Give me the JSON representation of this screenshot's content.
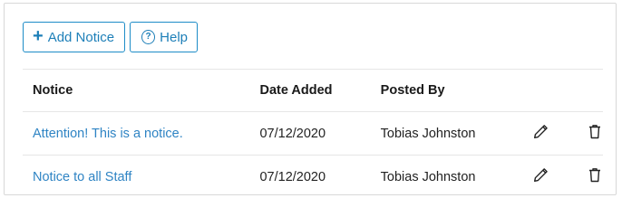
{
  "toolbar": {
    "add_label": "Add Notice",
    "help_label": "Help"
  },
  "icons": {
    "add": "plus-icon",
    "help": "question-circle-icon",
    "edit": "pencil-icon",
    "delete": "trash-icon"
  },
  "accent_color": "#1d8cc7",
  "table": {
    "headers": {
      "notice": "Notice",
      "date_added": "Date Added",
      "posted_by": "Posted By"
    },
    "rows": [
      {
        "notice": "Attention! This is a notice.",
        "date_added": "07/12/2020",
        "posted_by": "Tobias Johnston"
      },
      {
        "notice": "Notice to all Staff",
        "date_added": "07/12/2020",
        "posted_by": "Tobias Johnston"
      }
    ]
  }
}
